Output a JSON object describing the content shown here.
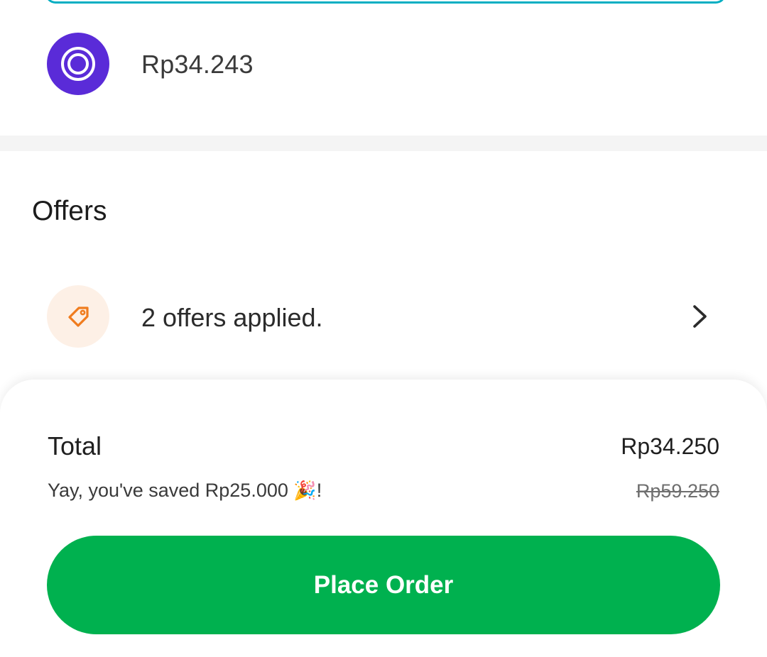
{
  "payment": {
    "icon": "wallet-ring-icon",
    "amount": "Rp34.243"
  },
  "offers": {
    "title": "Offers",
    "icon": "tag-icon",
    "applied_text": "2 offers applied.",
    "chevron": "chevron-right-icon"
  },
  "summary": {
    "total_label": "Total",
    "total_value": "Rp34.250",
    "saved_text": "Yay, you've saved Rp25.000 ",
    "saved_emoji": "🎉",
    "saved_suffix": "!",
    "original_price": "Rp59.250"
  },
  "actions": {
    "place_order_label": "Place Order"
  },
  "colors": {
    "brand_green": "#00b14f",
    "payment_icon_bg": "#5a2bd8",
    "offer_icon_bg": "#fdf0e6",
    "offer_icon_stroke": "#f07c1e",
    "accent_teal": "#00aec2"
  }
}
